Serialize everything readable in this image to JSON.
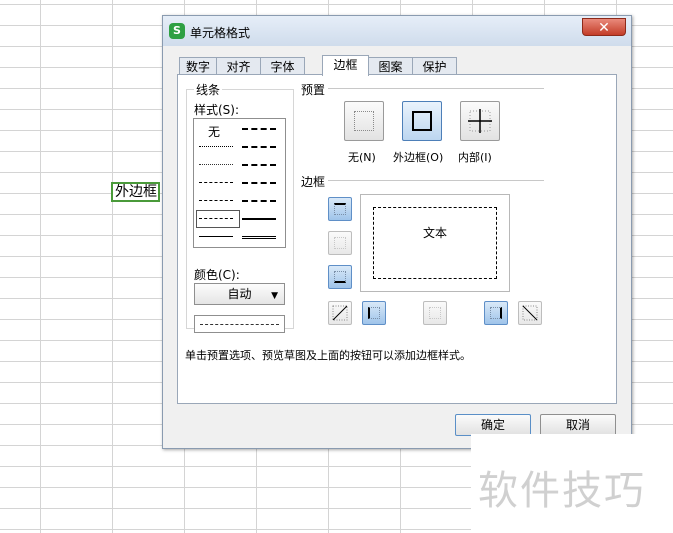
{
  "sheet": {
    "selected_cell_text": "外边框"
  },
  "dialog": {
    "title": "单元格格式",
    "app_icon_glyph": "S",
    "close_glyph": "✕",
    "tabs": [
      {
        "label": "数字"
      },
      {
        "label": "对齐"
      },
      {
        "label": "字体"
      },
      {
        "label": "边框",
        "active": true
      },
      {
        "label": "图案"
      },
      {
        "label": "保护"
      }
    ],
    "line_group": {
      "title": "线条",
      "style_label": "样式(S):",
      "none_label": "无",
      "color_label": "颜色(C):",
      "color_value": "自动",
      "color_dropdown_glyph": "▼"
    },
    "preset_group": {
      "title": "预置",
      "buttons": [
        {
          "label": "无(N)",
          "icon": "no-border-icon"
        },
        {
          "label": "外边框(O)",
          "icon": "outline-border-icon",
          "active": true
        },
        {
          "label": "内部(I)",
          "icon": "inside-border-icon"
        }
      ]
    },
    "border_group": {
      "title": "边框",
      "preview_text": "文本"
    },
    "hint": "单击预置选项、预览草图及上面的按钮可以添加边框样式。",
    "ok_label": "确定",
    "cancel_label": "取消"
  },
  "watermark": "软件技巧",
  "colors": {
    "accent": "#4d7fb8",
    "cell_border": "#4a9a3a",
    "close": "#c33d28"
  }
}
